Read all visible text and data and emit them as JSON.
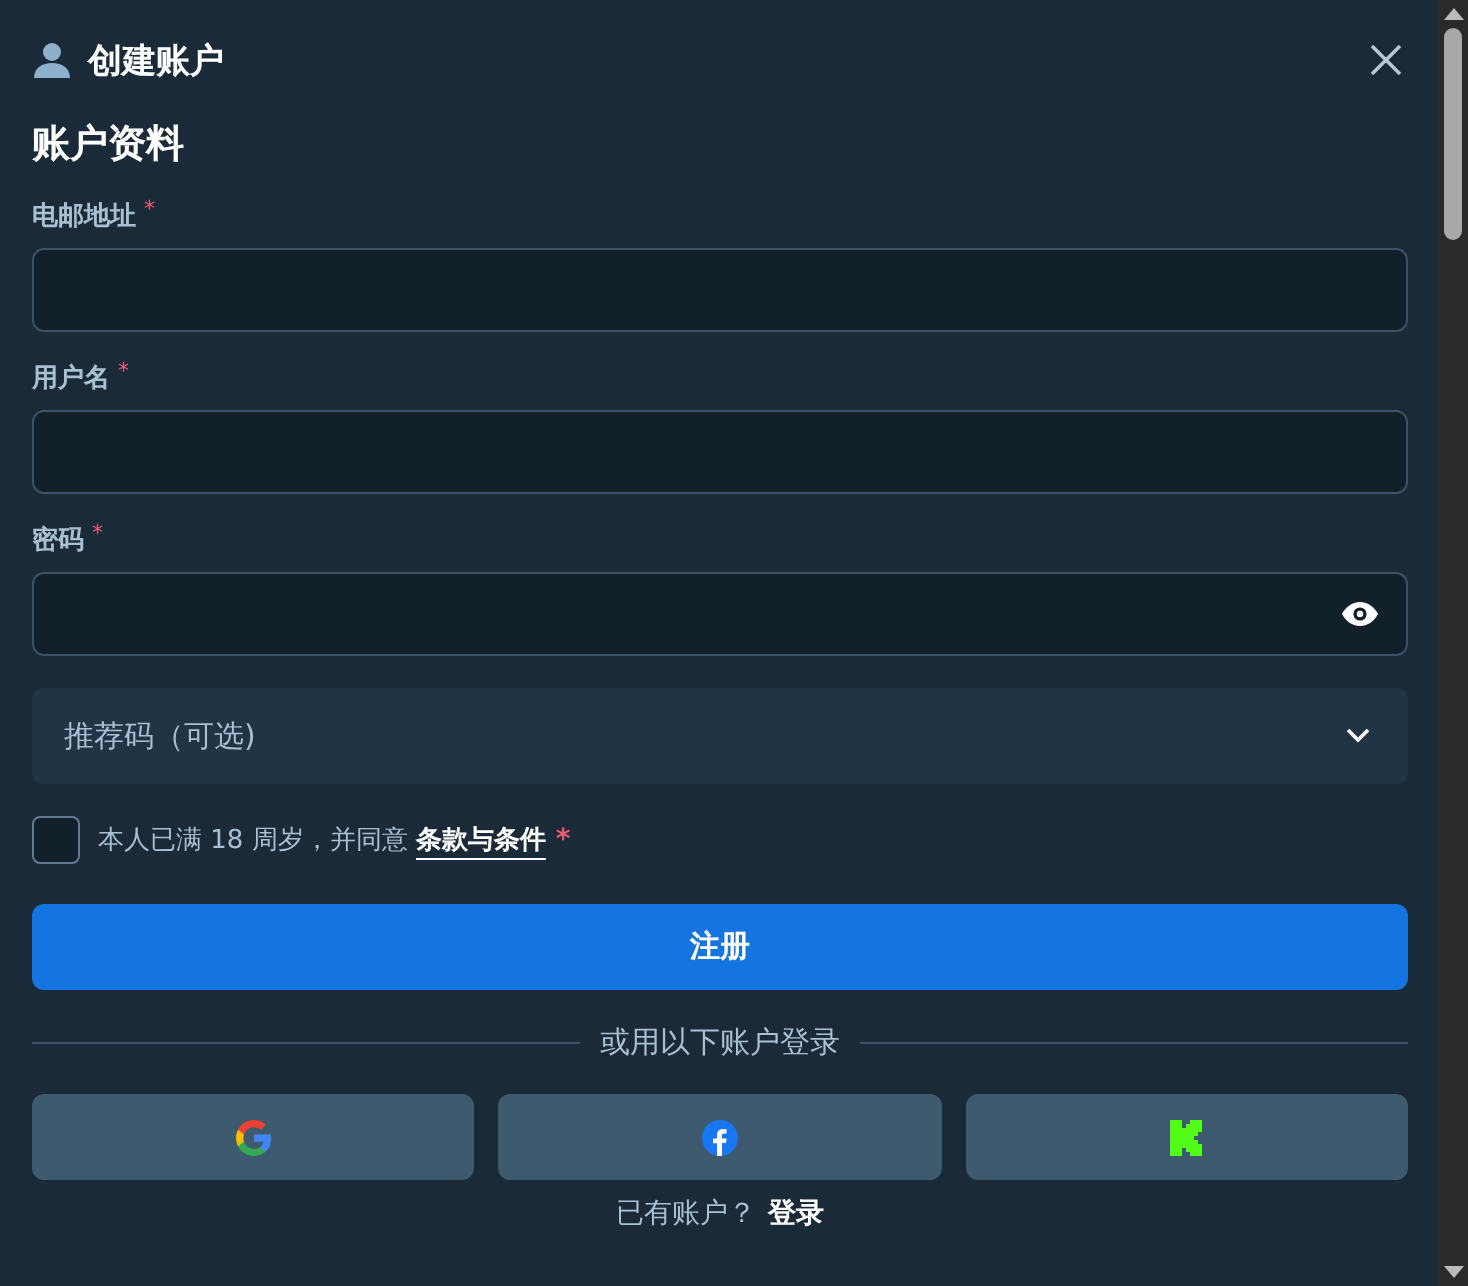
{
  "dialog": {
    "title": "创建账户"
  },
  "section_title": "账户资料",
  "fields": [
    {
      "label": "电邮地址",
      "required_mark": "*",
      "kind": "text"
    },
    {
      "label": "用户名",
      "required_mark": "*",
      "kind": "text"
    },
    {
      "label": "密码",
      "required_mark": "*",
      "kind": "password"
    }
  ],
  "referral": {
    "placeholder": "推荐码（可选)",
    "expanded": false
  },
  "agreement": {
    "text": "本人已满 18 周岁，并同意",
    "link": "条款与条件",
    "required_mark": "*",
    "checked": false
  },
  "submit": "注册",
  "divider_text": "或用以下账户登录",
  "social_buttons": [
    {
      "kind": "google"
    },
    {
      "kind": "facebook"
    },
    {
      "kind": "kick"
    }
  ],
  "footer": {
    "text": "已有账户？",
    "link": "登录"
  }
}
